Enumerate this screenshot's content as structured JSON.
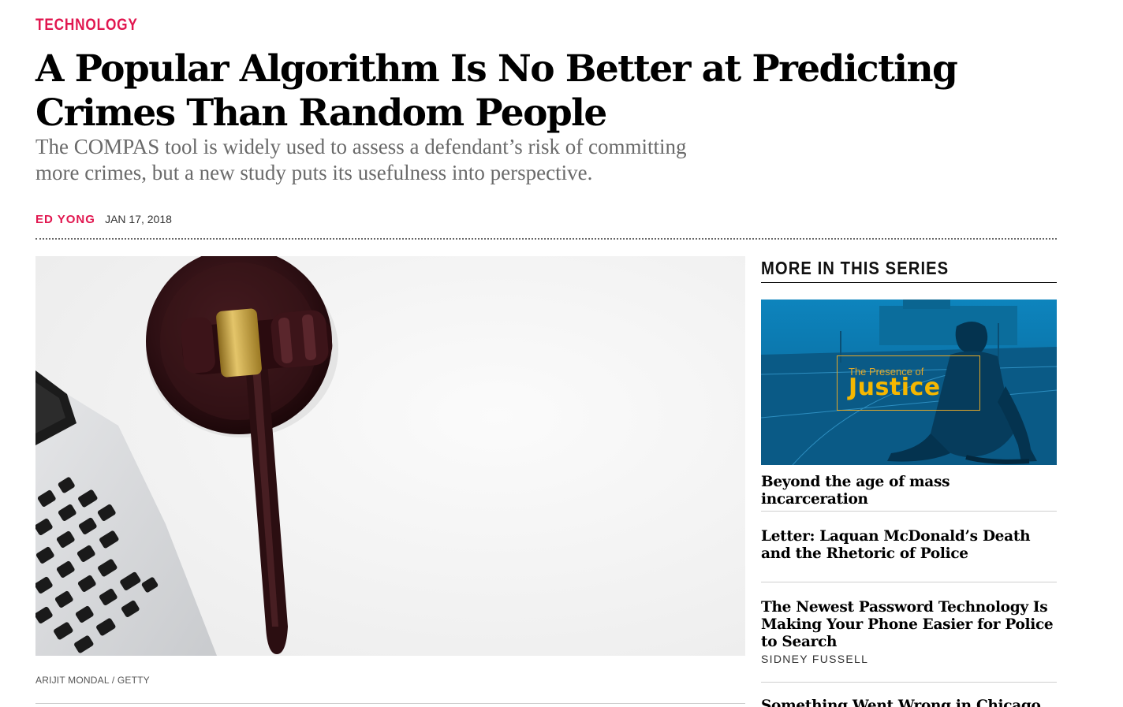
{
  "article": {
    "section": "TECHNOLOGY",
    "headline": "A Popular Algorithm Is No Better at Predicting Crimes Than Random People",
    "dek": "The COMPAS tool is widely used to assess a defendant’s risk of committing more crimes, but a new study puts its usefulness into perspective.",
    "author": "ED YONG",
    "date": "JAN 17, 2018",
    "image_credit": "ARIJIT MONDAL / GETTY"
  },
  "sidebar": {
    "heading": "MORE IN THIS SERIES",
    "series_logo": {
      "small": "The Presence of",
      "big": "Justice"
    },
    "items": [
      {
        "title": "Beyond the age of mass incarceration",
        "author": ""
      },
      {
        "title": "Letter: Laquan McDonald’s Death and the Rhetoric of Police",
        "author": ""
      },
      {
        "title": "The Newest Password Technology Is Making Your Phone Easier for Police to Search",
        "author": "SIDNEY FUSSELL"
      },
      {
        "title": "Something Went Wrong in Chicago",
        "author": ""
      }
    ]
  },
  "colors": {
    "accent": "#e1164f",
    "dek_gray": "#6a6a6a",
    "series_blue": "#0a6fa3",
    "series_gold": "#f5b700"
  }
}
